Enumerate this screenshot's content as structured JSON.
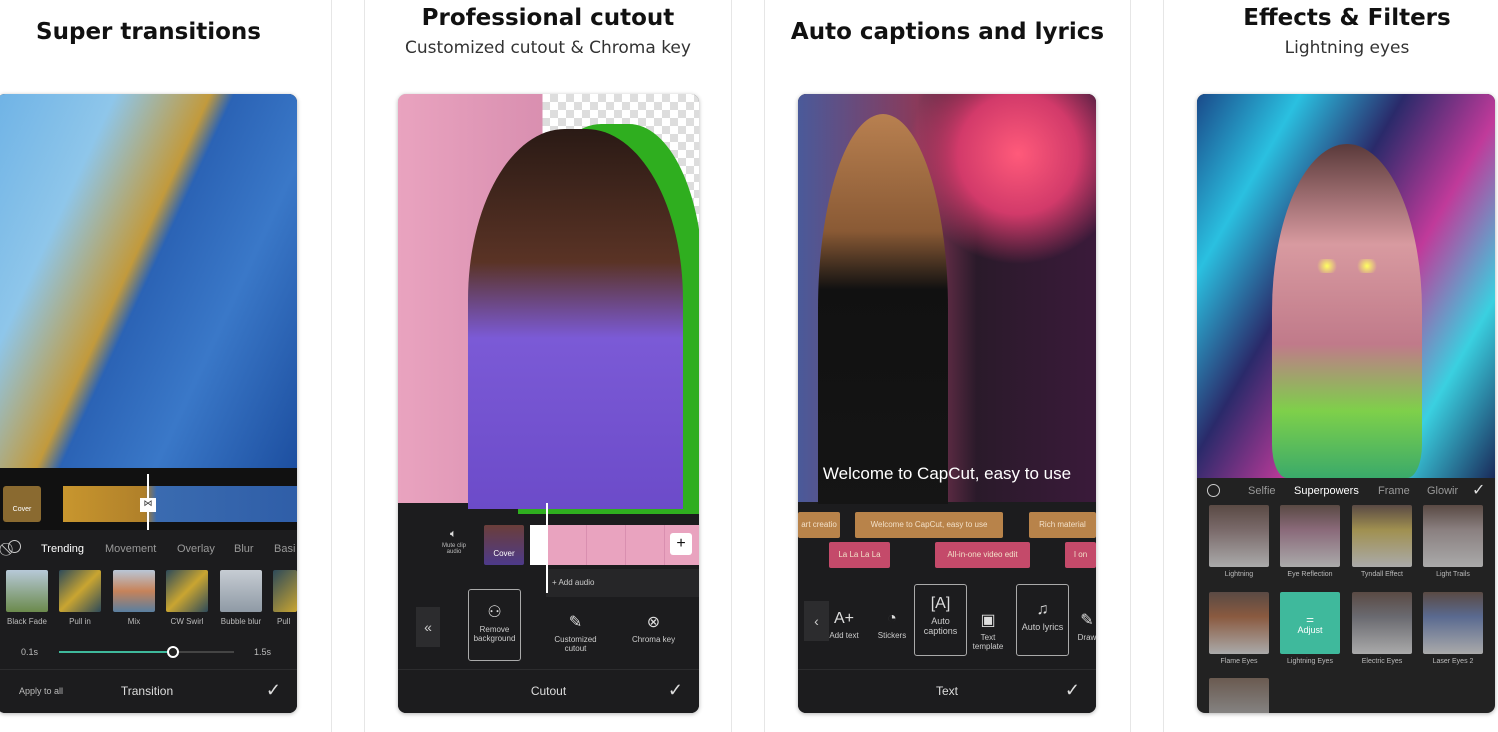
{
  "panels": [
    {
      "title": "Super transitions",
      "cover": "Cover",
      "tabs": [
        "Trending",
        "Movement",
        "Overlay",
        "Blur",
        "Basi"
      ],
      "transitions": [
        "Black Fade",
        "Pull in",
        "Mix",
        "CW Swirl",
        "Bubble blur",
        "Pull"
      ],
      "slider": {
        "min": "0.1s",
        "max": "1.5s",
        "value_fraction": 0.65
      },
      "apply_all": "Apply to all",
      "bottom": "Transition"
    },
    {
      "title": "Professional cutout",
      "subtitle": "Customized cutout & Chroma key",
      "mute": "Mute clip audio",
      "cover": "Cover",
      "add_audio": "+ Add audio",
      "tools": [
        "Remove background",
        "Customized cutout",
        "Chroma key"
      ],
      "bottom": "Cutout"
    },
    {
      "title": "Auto captions and lyrics",
      "caption": "Welcome to CapCut, easy to use",
      "track1": [
        "art creatio",
        "Welcome to CapCut,  easy to use",
        "Rich material"
      ],
      "track2": [
        "La La La La",
        "All-in-one video edit",
        "I on"
      ],
      "tools": [
        "Add text",
        "Stickers",
        "Auto captions",
        "Text template",
        "Auto lyrics",
        "Draw"
      ],
      "bottom": "Text"
    },
    {
      "title": "Effects & Filters",
      "subtitle": "Lightning eyes",
      "tabs": [
        "Selfie",
        "Superpowers",
        "Frame",
        "Glowir"
      ],
      "effects": [
        "Lightning",
        "Eye Reflection",
        "Tyndall Effect",
        "Light Trails",
        "Flame Eyes",
        "Lightning Eyes",
        "Electric Eyes",
        "Laser Eyes 2"
      ],
      "adjust": "Adjust"
    }
  ],
  "colors": {
    "accent": "#3fb99c",
    "track_orange": "#b8834a",
    "track_pink": "#c44a6a",
    "cutout_green": "#2fae1f"
  }
}
